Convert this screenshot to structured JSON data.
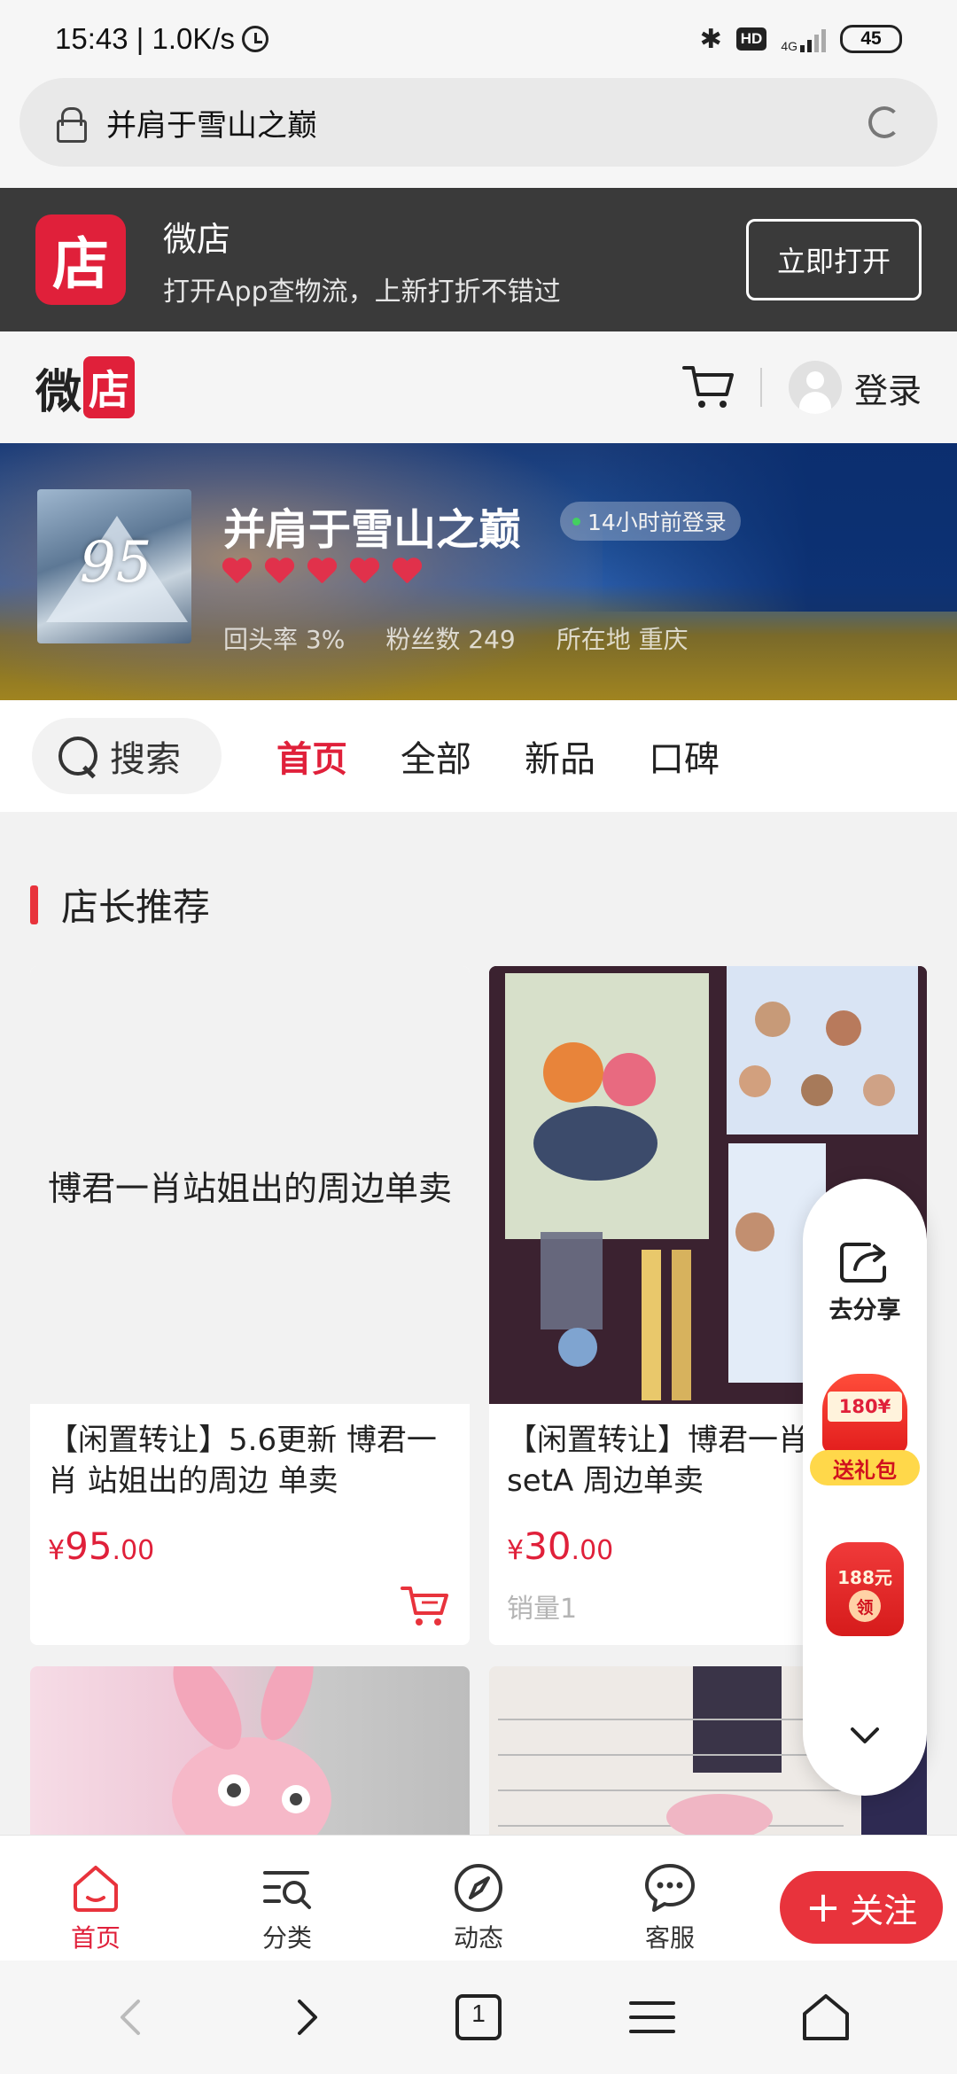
{
  "status_bar": {
    "time": "15:43 | 1.0K/s",
    "hd": "HD",
    "network": "4G",
    "battery": "45"
  },
  "url_bar": {
    "text": "并肩于雪山之巅"
  },
  "app_banner": {
    "logo_char": "店",
    "name": "微店",
    "desc": "打开App查物流，上新打折不错过",
    "open_label": "立即打开"
  },
  "site_header": {
    "brand_wei": "微",
    "brand_dian": "店",
    "login_label": "登录"
  },
  "shop": {
    "logo_number": "95",
    "name": "并肩于雪山之巅",
    "online_status": "14小时前登录",
    "hearts": 5,
    "stats": {
      "return_rate": "回头率 3%",
      "fans": "粉丝数 249",
      "location": "所在地 重庆"
    }
  },
  "nav_tabs": {
    "search_label": "搜索",
    "tabs": [
      "首页",
      "全部",
      "新品",
      "口碑"
    ],
    "active": "首页"
  },
  "section": {
    "title": "店长推荐"
  },
  "products": [
    {
      "thumb_text": "博君一肖站姐出的周边单卖",
      "name": "【闲置转让】5.6更新 博君一肖 站姐出的周边 单卖",
      "price_currency": "¥",
      "price_int": "95",
      "price_dec": ".00"
    },
    {
      "name": "【闲置转让】博君一肖 狂想 setA 周边单卖",
      "price_currency": "¥",
      "price_int": "30",
      "price_dec": ".00",
      "sales": "销量1"
    }
  ],
  "float_panel": {
    "share_label": "去分享",
    "gift_amount": "180¥",
    "gift_label": "送礼包",
    "coupon_amount": "188元",
    "coupon_get": "领"
  },
  "tab_bar": {
    "items": [
      "首页",
      "分类",
      "动态",
      "客服"
    ],
    "active": "首页",
    "follow_label": "关注"
  },
  "browser_nav": {
    "tab_count": "1"
  },
  "colors": {
    "accent": "#e0203a",
    "banner_dark": "#3a3a3a",
    "price": "#e0203a"
  }
}
